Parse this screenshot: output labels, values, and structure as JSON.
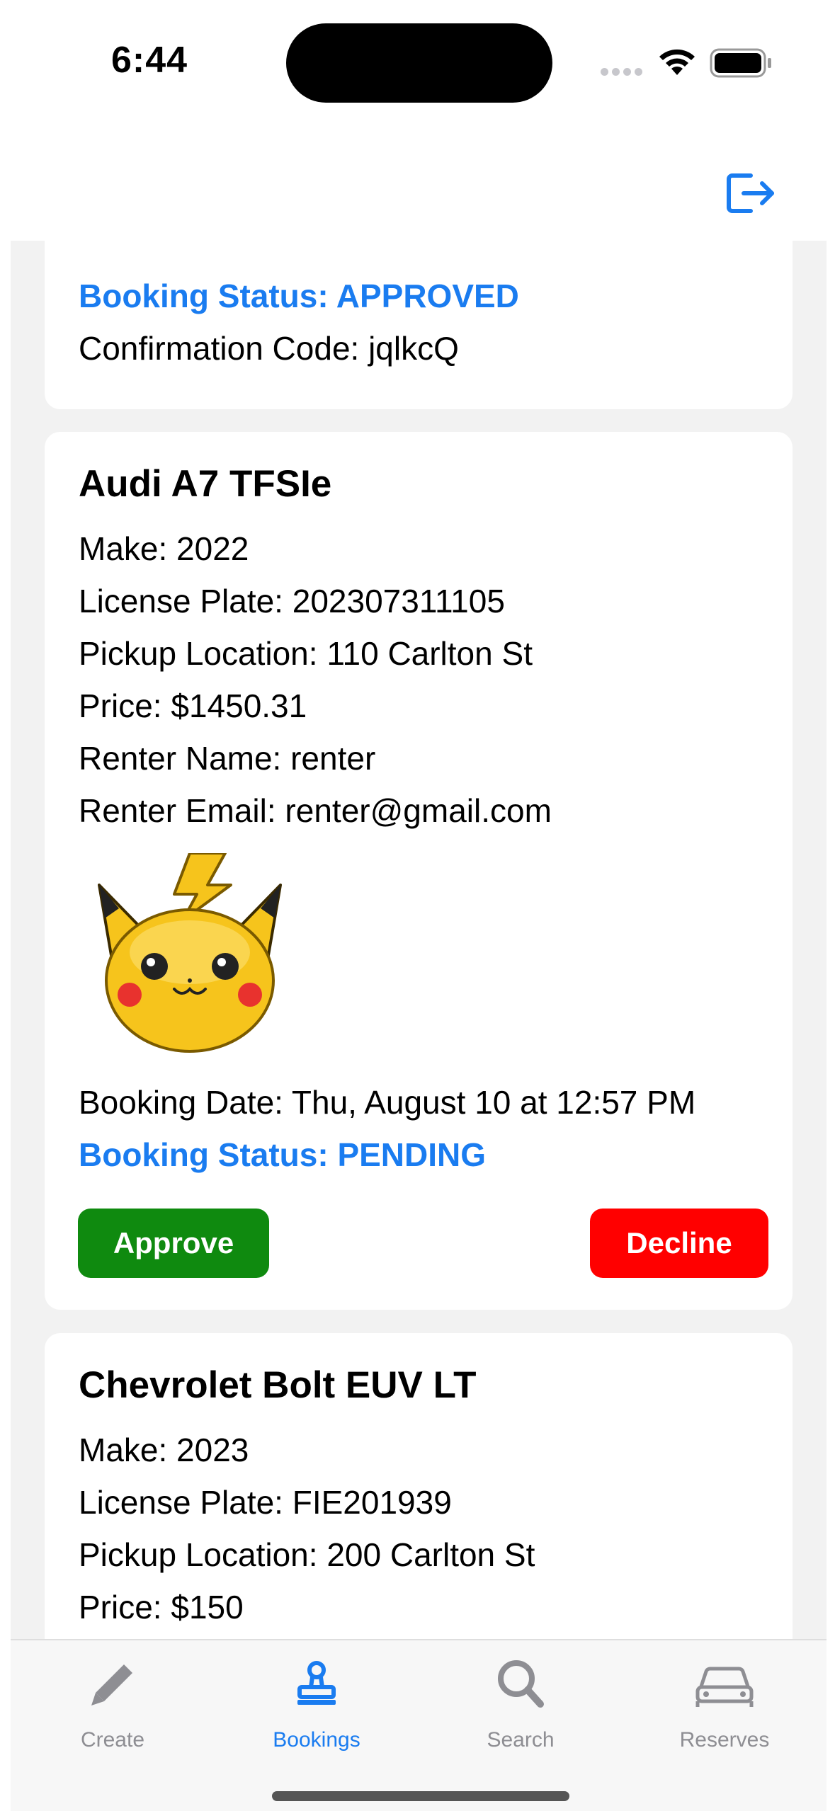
{
  "status_bar": {
    "time": "6:44"
  },
  "bookings": [
    {
      "status_text": "Booking Status: APPROVED",
      "confirmation": "Confirmation Code: jqlkcQ"
    },
    {
      "title": "Audi A7 TFSIe",
      "make": "Make: 2022",
      "plate": "License Plate: 202307311105",
      "pickup": "Pickup Location: 110 Carlton St",
      "price": "Price: $1450.31",
      "renter_name": "Renter Name: renter",
      "renter_email": "Renter Email: renter@gmail.com",
      "avatar": "pikachu-image",
      "booking_date": "Booking Date: Thu, August 10 at 12:57 PM",
      "status_text": "Booking Status: PENDING",
      "approve_label": "Approve",
      "decline_label": "Decline"
    },
    {
      "title": "Chevrolet Bolt EUV LT",
      "make": "Make: 2023",
      "plate": "License Plate: FIE201939",
      "pickup": "Pickup Location: 200 Carlton St",
      "price": "Price: $150"
    }
  ],
  "tabs": [
    {
      "label": "Create",
      "icon": "pencil-icon",
      "active": false
    },
    {
      "label": "Bookings",
      "icon": "stamp-icon",
      "active": true
    },
    {
      "label": "Search",
      "icon": "search-icon",
      "active": false
    },
    {
      "label": "Reserves",
      "icon": "car-icon",
      "active": false
    }
  ],
  "colors": {
    "accent": "#1a7cf0",
    "approve": "#0f8a0f",
    "decline": "#ff0000",
    "inactive_tab": "#8e8e93",
    "background": "#f2f2f2"
  }
}
